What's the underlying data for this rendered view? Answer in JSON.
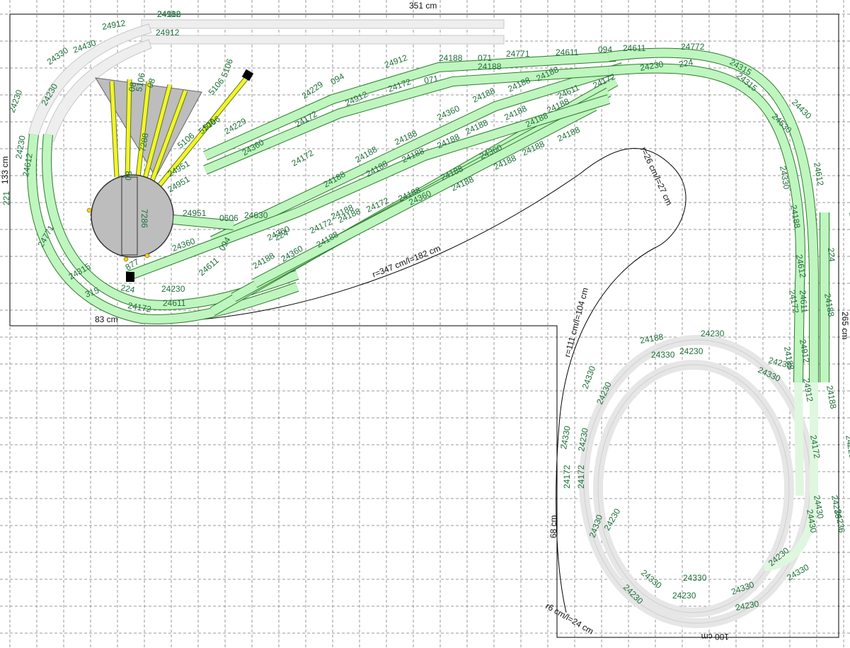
{
  "colors": {
    "green_track_fill": "#bff5bf",
    "green_track_edge": "#2d7a2d",
    "gray_track_fill": "#eeeeee",
    "gray_track_edge": "#c8c8c8",
    "turntable_fill": "#bdbdbd",
    "yellow_track": "#f4f42a",
    "label_color": "#1f6f3a",
    "grid_color": "#9a9a9a"
  },
  "dimensions": {
    "top_width": "351 cm",
    "left_height": "133 cm",
    "right_height": "265 cm",
    "bottom_left_width": "83 cm",
    "bottom_right_width": "100 cm",
    "lower_left_height": "68 cm",
    "arc_main": "r=347 cm/l=182 cm",
    "arc_inner": "r=26 cm/l=27 cm",
    "arc_lower": "r=111 cm/l=104 cm",
    "arc_bottom": "r6 cm/l=24 cm"
  },
  "turntable": {
    "label": "7286"
  },
  "track_labels": [
    "24912",
    "24912",
    "24912",
    "24430",
    "24330",
    "24230",
    "24230",
    "24230",
    "24612",
    "221",
    "24771",
    "24315",
    "315",
    "224",
    "24172",
    "24611",
    "24230",
    "877",
    "24360",
    "24611",
    "094",
    "24951",
    "0606",
    "24630",
    "24360",
    "24951",
    "24951",
    "5106",
    "5106",
    "5106",
    "5106",
    "7288",
    "5106",
    "08",
    "08",
    "08",
    "5106",
    "24229",
    "24229",
    "094",
    "24912",
    "24172",
    "24912",
    "24172",
    "071",
    "24188",
    "071",
    "24188",
    "24771",
    "24611",
    "094",
    "24611",
    "24772",
    "24230",
    "224",
    "24315",
    "24315",
    "24360",
    "24172",
    "24188",
    "24188",
    "24360",
    "24188",
    "24188",
    "24188",
    "24188",
    "24188",
    "24188",
    "24188",
    "24188",
    "24188",
    "24360",
    "24188",
    "24188",
    "24188",
    "24188",
    "24188",
    "24172",
    "24188",
    "24188",
    "24360",
    "24188",
    "24188",
    "24611",
    "24172",
    "224",
    "24172",
    "24188",
    "24188",
    "24360",
    "24188",
    "24188",
    "24330",
    "24230",
    "24230",
    "24330",
    "24230",
    "24330",
    "24230",
    "24330",
    "24230",
    "24172",
    "24172",
    "24330",
    "24230",
    "24230",
    "24330",
    "24230",
    "24330",
    "24230",
    "24330",
    "24230",
    "24330",
    "24230",
    "24430",
    "24330",
    "24612",
    "24188",
    "24612",
    "24172",
    "24188",
    "24188",
    "24912",
    "24912",
    "24188",
    "24172",
    "24229",
    "24236",
    "24430",
    "24430",
    "24530",
    "24771",
    "224",
    "24611",
    "24188"
  ]
}
